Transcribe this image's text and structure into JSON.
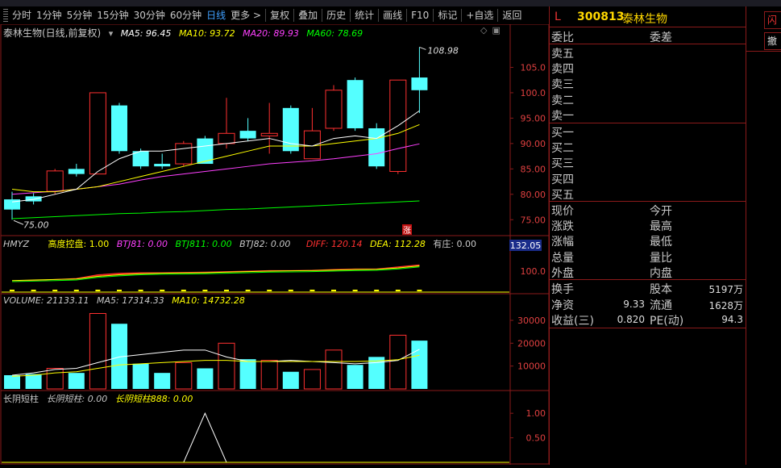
{
  "toolbar": {
    "items": [
      "分时",
      "1分钟",
      "5分钟",
      "15分钟",
      "30分钟",
      "60分钟",
      "日线",
      "更多"
    ],
    "active_index": 6,
    "more_arrow": ">",
    "tools": [
      "复权",
      "叠加",
      "历史",
      "统计",
      "画线",
      "F10",
      "标记",
      "+自选",
      "返回"
    ]
  },
  "main_header": {
    "title": "泰林生物(日线,前复权)",
    "ma5": "MA5: 96.45",
    "ma10": "MA10: 93.72",
    "ma20": "MA20: 89.93",
    "ma60": "MA60: 78.69",
    "high_label": "108.98",
    "low_label": "75.00",
    "badge": "涨",
    "y_ticks": [
      "105.0",
      "100.0",
      "95.00",
      "90.00",
      "85.00",
      "80.00",
      "75.00"
    ]
  },
  "hmyz": {
    "name": "HMYZ",
    "gdkp": "高度控盘: 1.00",
    "btj81": "BTJ81: 0.00",
    "btj811": "BTJ811: 0.00",
    "btj82": "BTJ82: 0.00",
    "diff": "DIFF: 120.14",
    "dea": "DEA: 112.28",
    "youzhuang": "有庄: 0.00",
    "value_box": "132.05",
    "y_tick": "100.0"
  },
  "volume": {
    "name": "VOLUME: 21133.11",
    "ma5": "MA5: 17314.33",
    "ma10": "MA10: 14732.28",
    "y_ticks": [
      "30000",
      "20000",
      "10000"
    ]
  },
  "cyzd": {
    "name": "长阴短柱",
    "a": "长阴短柱: 0.00",
    "b": "长阴短柱888: 0.00",
    "y_ticks": [
      "1.00",
      "0.50"
    ]
  },
  "quote": {
    "flag": "L",
    "code": "300813",
    "name": "泰林生物",
    "weibi": "委比",
    "weicha": "委差",
    "sell": [
      "卖五",
      "卖四",
      "卖三",
      "卖二",
      "卖一"
    ],
    "buy": [
      "买一",
      "买二",
      "买三",
      "买四",
      "买五"
    ],
    "left_labels": [
      "现价",
      "涨跌",
      "涨幅",
      "总量",
      "外盘"
    ],
    "right_labels": [
      "今开",
      "最高",
      "最低",
      "量比",
      "内盘"
    ],
    "stats": [
      {
        "l": "换手",
        "lv": "",
        "r": "股本",
        "rv": "5197万"
      },
      {
        "l": "净资",
        "lv": "9.33",
        "r": "流通",
        "rv": "1628万"
      },
      {
        "l": "收益(三)",
        "lv": "0.820",
        "r": "PE(动)",
        "rv": "94.3"
      }
    ]
  },
  "far_right": {
    "btn1": "闪",
    "btn2": "撤"
  },
  "colors": {
    "up": "#ff3030",
    "down": "#54ffff",
    "ma5": "#ffffff",
    "ma10": "#ffff00",
    "ma20": "#ff40ff",
    "ma60": "#00ff00",
    "accent": "#3fa0ff"
  },
  "chart_data": {
    "type": "candlestick",
    "candles": [
      {
        "o": 79.0,
        "c": 77.0,
        "h": 80.5,
        "l": 75.0
      },
      {
        "o": 79.6,
        "c": 78.6,
        "h": 80.2,
        "l": 78.0
      },
      {
        "o": 80.6,
        "c": 84.6,
        "h": 85.0,
        "l": 80.0
      },
      {
        "o": 85.0,
        "c": 84.0,
        "h": 86.0,
        "l": 83.5
      },
      {
        "o": 84.0,
        "c": 100.0,
        "h": 100.0,
        "l": 84.0
      },
      {
        "o": 97.5,
        "c": 88.5,
        "h": 98.0,
        "l": 88.0
      },
      {
        "o": 88.5,
        "c": 85.5,
        "h": 89.0,
        "l": 85.0
      },
      {
        "o": 86.0,
        "c": 85.5,
        "h": 88.0,
        "l": 85.0
      },
      {
        "o": 86.0,
        "c": 90.0,
        "h": 90.5,
        "l": 85.5
      },
      {
        "o": 91.0,
        "c": 86.0,
        "h": 91.5,
        "l": 86.0
      },
      {
        "o": 90.0,
        "c": 92.0,
        "h": 99.0,
        "l": 89.0
      },
      {
        "o": 92.5,
        "c": 91.0,
        "h": 95.0,
        "l": 90.5
      },
      {
        "o": 91.5,
        "c": 92.0,
        "h": 98.0,
        "l": 88.0
      },
      {
        "o": 97.0,
        "c": 88.5,
        "h": 97.5,
        "l": 88.0
      },
      {
        "o": 87.0,
        "c": 92.5,
        "h": 97.0,
        "l": 87.0
      },
      {
        "o": 93.0,
        "c": 100.5,
        "h": 101.5,
        "l": 92.5
      },
      {
        "o": 102.5,
        "c": 93.0,
        "h": 103.0,
        "l": 92.5
      },
      {
        "o": 93.0,
        "c": 85.5,
        "h": 94.0,
        "l": 85.0
      },
      {
        "o": 84.5,
        "c": 102.5,
        "h": 102.5,
        "l": 84.0
      },
      {
        "o": 103.0,
        "c": 100.5,
        "h": 108.98,
        "l": 96.0
      }
    ],
    "ma5": [
      78.5,
      79.0,
      80.0,
      81.0,
      84.5,
      87.0,
      88.5,
      88.5,
      89.0,
      89.5,
      90.0,
      90.5,
      91.0,
      90.0,
      89.5,
      91.0,
      91.5,
      91.0,
      93.5,
      96.45
    ],
    "ma10": [
      81.0,
      80.5,
      80.5,
      81.0,
      81.5,
      82.5,
      83.5,
      84.5,
      85.5,
      86.5,
      87.5,
      88.5,
      89.5,
      89.5,
      89.5,
      90.0,
      90.5,
      91.0,
      92.0,
      93.72
    ],
    "ma20": [
      80.0,
      80.3,
      80.6,
      81.0,
      81.5,
      82.0,
      82.8,
      83.5,
      84.0,
      84.5,
      85.0,
      85.5,
      86.0,
      86.3,
      86.6,
      87.0,
      87.5,
      88.0,
      89.0,
      89.93
    ],
    "ma60": [
      75.2,
      75.4,
      75.6,
      75.8,
      76.0,
      76.2,
      76.3,
      76.5,
      76.6,
      76.8,
      77.0,
      77.1,
      77.3,
      77.5,
      77.7,
      77.9,
      78.1,
      78.3,
      78.5,
      78.69
    ],
    "volumes": [
      6000,
      6500,
      9000,
      7000,
      33000,
      28500,
      11000,
      7000,
      11500,
      9000,
      20000,
      13000,
      12500,
      7500,
      8500,
      17000,
      10500,
      14000,
      23500,
      21133
    ],
    "vol_ma5": [
      6000,
      7000,
      8500,
      9000,
      11500,
      14000,
      15000,
      16000,
      17000,
      17000,
      14000,
      12000,
      12000,
      12500,
      12000,
      11500,
      11000,
      11500,
      12500,
      17314
    ],
    "vol_ma10": [
      5500,
      6000,
      7000,
      7500,
      9000,
      10500,
      11000,
      11500,
      12000,
      12500,
      12500,
      12000,
      12000,
      12000,
      12000,
      12000,
      12000,
      12200,
      12800,
      14732
    ],
    "price_ylim": [
      72.5,
      110
    ],
    "vol_ylim": [
      0,
      36000
    ],
    "cyzd_values": [
      0,
      0,
      0,
      0,
      0,
      0,
      0,
      0,
      0,
      1,
      0,
      0,
      0,
      0,
      0,
      0,
      0,
      0,
      0,
      0
    ]
  }
}
